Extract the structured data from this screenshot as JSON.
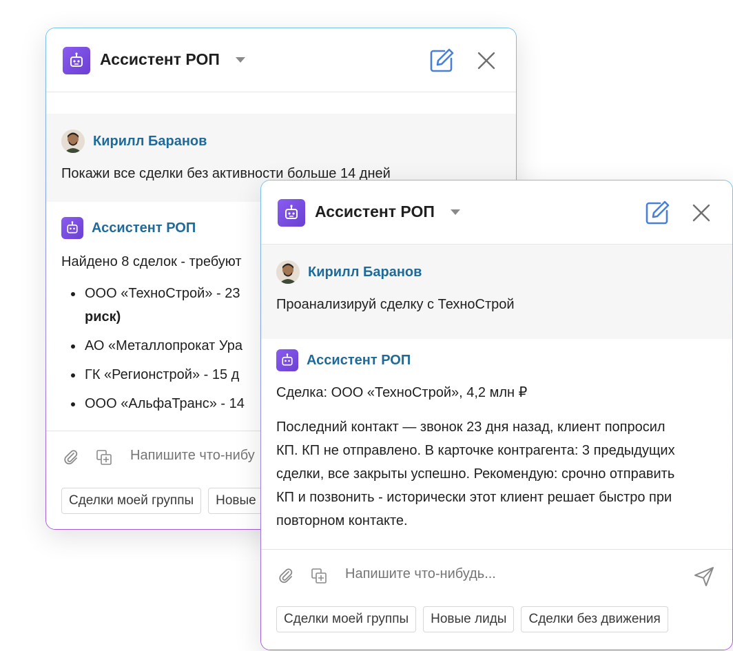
{
  "back_window": {
    "title": "Ассистент РОП",
    "user": {
      "name": "Кирилл Баранов",
      "message": "Покажи все сделки без активности больше 14 дней"
    },
    "bot": {
      "name": "Ассистент РОП",
      "intro": "Найдено 8 сделок - требуют",
      "items": [
        {
          "text": "ООО «ТехноСтрой» - 23",
          "cont": "риск)"
        },
        {
          "text": "АО «Металлопрокат Ура"
        },
        {
          "text": "ГК «Регионстрой» - 15 д"
        },
        {
          "text": "ООО «АльфаТранс» - 14"
        }
      ]
    },
    "input_placeholder": "Напишите что-нибу",
    "chips": [
      "Сделки моей группы",
      "Новые"
    ]
  },
  "front_window": {
    "title": "Ассистент РОП",
    "user": {
      "name": "Кирилл Баранов",
      "message": "Проанализируй сделку с ТехноСтрой"
    },
    "bot": {
      "name": "Ассистент РОП",
      "deal": "Сделка: ООО «ТехноСтрой», 4,2 млн ₽",
      "paragraph_lines": [
        "Последний контакт — звонок 23 дня назад, клиент попросил",
        "КП. КП не отправлено. В карточке контрагента: 3 предыдущих",
        "сделки, все закрыты успешно. Рекомендую: срочно отправить",
        "КП и позвонить - исторически этот клиент решает быстро при",
        "повторном контакте."
      ]
    },
    "input_placeholder": "Напишите что-нибудь...",
    "chips": [
      "Сделки моей группы",
      "Новые лиды",
      "Сделки без движения"
    ]
  },
  "icons": {
    "logo": "robot-icon",
    "caret": "chevron-down-icon",
    "edit": "edit-icon",
    "close": "close-icon",
    "attach": "paperclip-icon",
    "copy": "copy-add-icon",
    "send": "send-icon"
  },
  "colors": {
    "accent_purple": "#7b4ce6",
    "name_blue": "#1e6a99",
    "edit_blue": "#4a7fd4"
  }
}
